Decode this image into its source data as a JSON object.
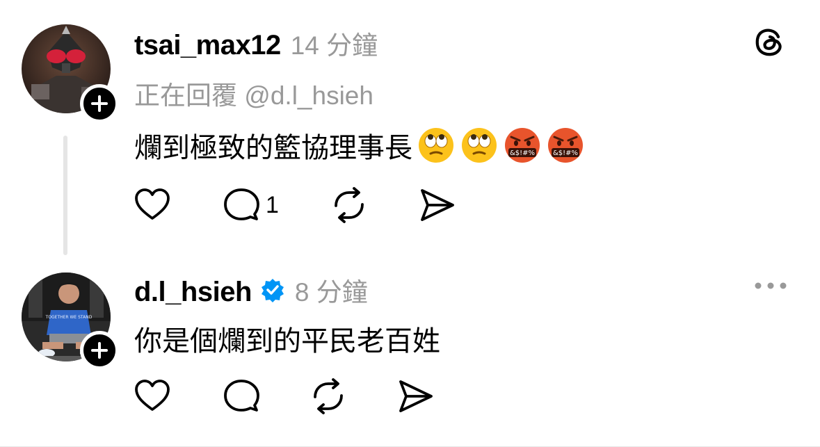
{
  "posts": [
    {
      "username": "tsai_max12",
      "time": "14 分鐘",
      "replying_to": "正在回覆 @d.l_hsieh",
      "text": "爛到極致的籃協理事長",
      "emojis": [
        "face-with-rolling-eyes",
        "face-with-rolling-eyes",
        "face-with-symbols-on-mouth",
        "face-with-symbols-on-mouth"
      ],
      "reply_count": "1"
    },
    {
      "username": "d.l_hsieh",
      "time": "8 分鐘",
      "verified": true,
      "text": "你是個爛到的平民老百姓"
    }
  ],
  "emoji_symbol_text": "&$!#%",
  "avatar_shirt_text": "TOGETHER WE STAND",
  "colors": {
    "secondary_text": "#999999",
    "verified_badge": "#0095f6",
    "thread_line": "#e5e5e5"
  }
}
